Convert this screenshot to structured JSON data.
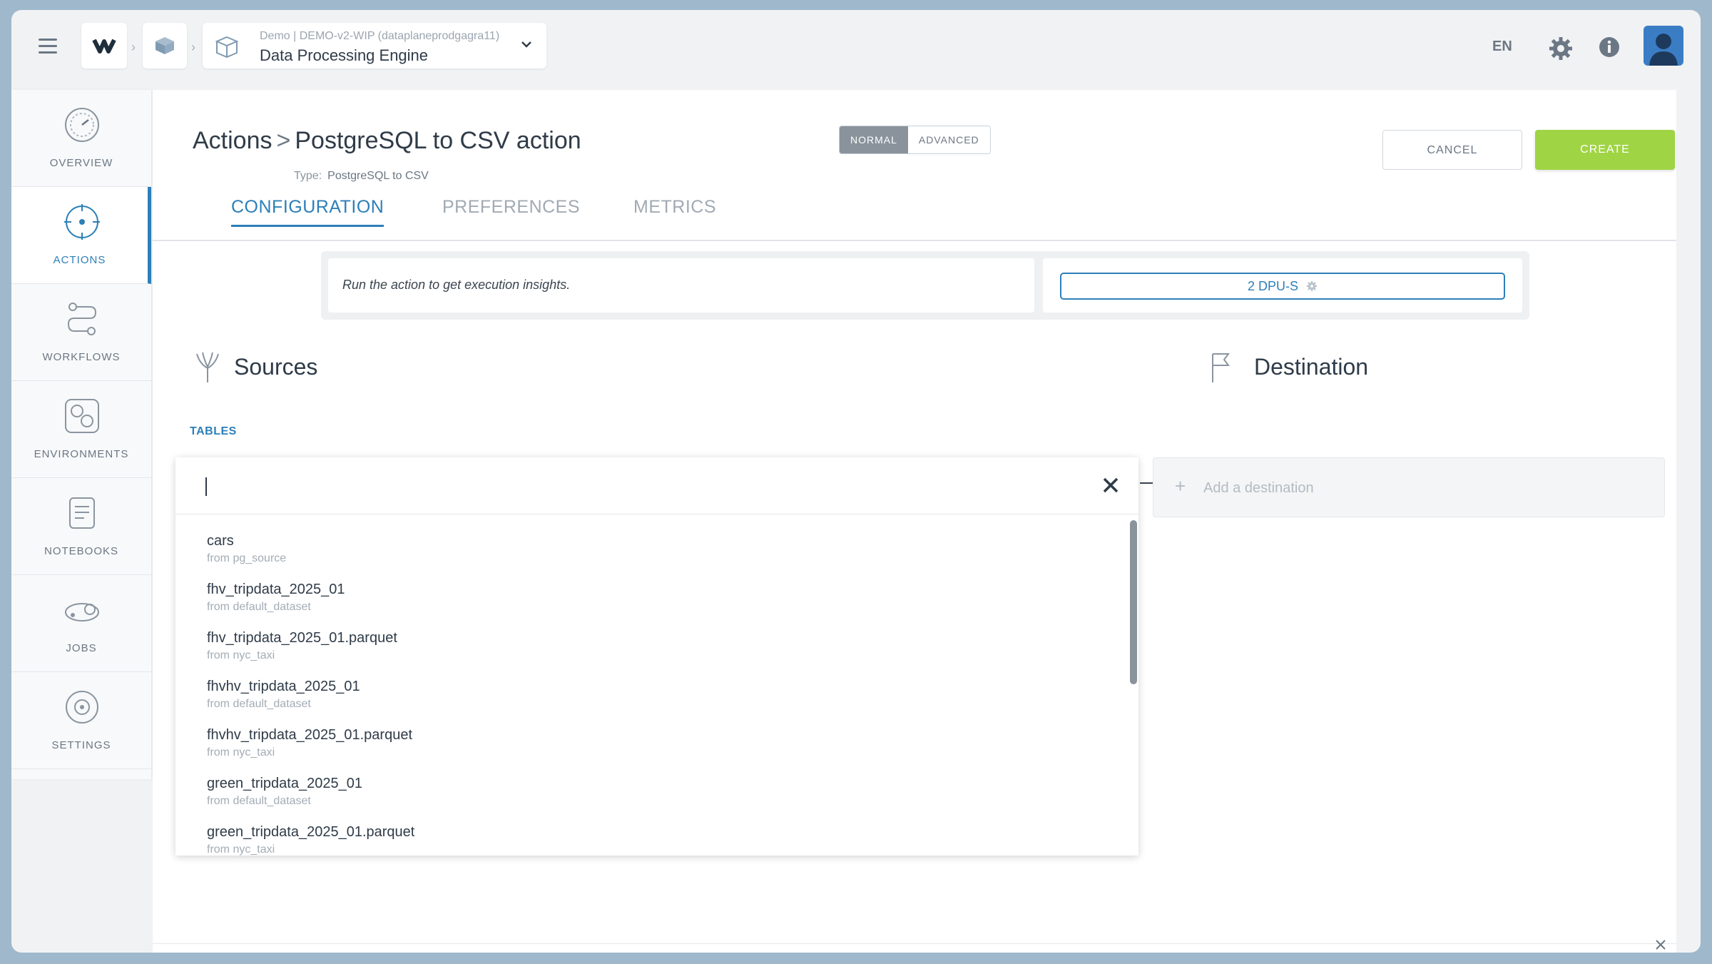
{
  "topbar": {
    "project_subtitle": "Demo | DEMO-v2-WIP (dataplaneprodgagra11)",
    "project_title": "Data Processing Engine",
    "language": "EN"
  },
  "sidebar": {
    "items": [
      {
        "label": "OVERVIEW",
        "icon": "overview-dial-icon"
      },
      {
        "label": "ACTIONS",
        "icon": "actions-target-icon",
        "active": true
      },
      {
        "label": "WORKFLOWS",
        "icon": "workflows-icon"
      },
      {
        "label": "ENVIRONMENTS",
        "icon": "environments-icon"
      },
      {
        "label": "NOTEBOOKS",
        "icon": "notebooks-icon"
      },
      {
        "label": "JOBS",
        "icon": "jobs-icon"
      },
      {
        "label": "SETTINGS",
        "icon": "settings-icon"
      }
    ]
  },
  "header": {
    "breadcrumb_root": "Actions",
    "breadcrumb_sep": ">",
    "action_name": "PostgreSQL to CSV action",
    "type_label": "Type:",
    "type_value": "PostgreSQL to CSV",
    "mode_normal": "NORMAL",
    "mode_advanced": "ADVANCED",
    "cancel_label": "CANCEL",
    "create_label": "CREATE"
  },
  "tabs": [
    {
      "label": "CONFIGURATION",
      "active": true
    },
    {
      "label": "PREFERENCES",
      "active": false
    },
    {
      "label": "METRICS",
      "active": false
    }
  ],
  "insights": {
    "message": "Run the action to get execution insights.",
    "dpu_label": "2 DPU-S"
  },
  "sources": {
    "title": "Sources",
    "tables_label": "TABLES",
    "search_value": "",
    "items": [
      {
        "name": "cars",
        "from": "from pg_source"
      },
      {
        "name": "fhv_tripdata_2025_01",
        "from": "from default_dataset"
      },
      {
        "name": "fhv_tripdata_2025_01.parquet",
        "from": "from nyc_taxi"
      },
      {
        "name": "fhvhv_tripdata_2025_01",
        "from": "from default_dataset"
      },
      {
        "name": "fhvhv_tripdata_2025_01.parquet",
        "from": "from nyc_taxi"
      },
      {
        "name": "green_tripdata_2025_01",
        "from": "from default_dataset"
      },
      {
        "name": "green_tripdata_2025_01.parquet",
        "from": "from nyc_taxi"
      }
    ]
  },
  "destination": {
    "title": "Destination",
    "add_label": "Add a destination"
  },
  "colors": {
    "accent": "#2d7fb8",
    "create": "#9fd444",
    "frame": "#9fb8cc"
  }
}
